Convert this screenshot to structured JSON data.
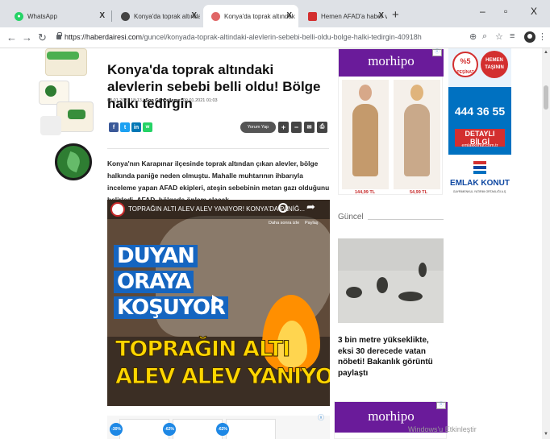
{
  "browser": {
    "tabs": [
      {
        "title": "WhatsApp",
        "favicon_color": "#25d366",
        "active": false
      },
      {
        "title": "Konya'da toprak altındaki alevlerin",
        "favicon_color": "#444444",
        "active": false
      },
      {
        "title": "Konya'da toprak altındaki alevle",
        "favicon_color": "#e06666",
        "active": true
      },
      {
        "title": "Hemen AFAD'a haber verdiler! To",
        "favicon_color": "#d32f2f",
        "active": false
      }
    ],
    "tab_close": "X",
    "new_tab": "+",
    "window_controls": {
      "minimize": "–",
      "maximize": "▫",
      "close": "X"
    },
    "url_host": "https://haberdairesi.com",
    "url_path": "/guncel/konyada-toprak-altindaki-alevlerin-sebebi-belli-oldu-bolge-halki-tedirgin-40918h",
    "icons": [
      "back-icon",
      "forward-icon",
      "reload-icon",
      "lock-icon",
      "translate-icon",
      "zoom-icon",
      "star-icon",
      "playlist-icon",
      "profile-icon",
      "menu-icon"
    ]
  },
  "article": {
    "headline": "Konya'da toprak altındaki alevlerin sebebi belli oldu! Bölge halkı tedirgin",
    "published": "08.01.2021 18:13",
    "updated_label": "Son Güncelleme:",
    "updated": "09.01.2021 01:03",
    "share": [
      "f",
      "t",
      "in",
      "w"
    ],
    "share_colors": [
      "#3b5998",
      "#1da1f2",
      "#0077b5",
      "#25d366"
    ],
    "comment_button": "Yorum Yap",
    "font_plus": "+",
    "font_minus": "−",
    "lead": "Konya'nın Karapınar ilçesinde toprak altından çıkan alevler, bölge halkında paniğe neden olmuştu. Mahalle muhtarının ihbarıyla inceleme yapan AFAD ekipleri, ateşin sebebinin metan gazı olduğunu belirledi. AFAD, bölgede önlem alacak."
  },
  "video": {
    "title": "TOPRAĞIN ALTI ALEV ALEV YANIYOR! KONYA'DA PANİĞ...",
    "watch_later": "Daha sonra izle",
    "share_label": "Paylaş",
    "overlay_lines": [
      "DUYAN",
      "ORAYA",
      "KOŞUYOR",
      "TOPRAĞIN ALTI",
      "ALEV ALEV YANIYOR"
    ]
  },
  "bottom_ad": {
    "discounts": [
      "-30%",
      "-62%",
      "-62%"
    ],
    "close": "ⓧ"
  },
  "right_ads": {
    "morhipo": {
      "brand": "morhipo",
      "chip": "ⓧ",
      "prices": [
        "144,99 TL",
        "54,99 TL"
      ]
    },
    "emlak": {
      "percent": "%5",
      "pesinat": "PEŞİNAT",
      "hemen_line1": "HEMEN",
      "hemen_line2": "TAŞININ",
      "phone_line1": "444 36 55",
      "detayli": "DETAYLI BİLGİ",
      "url": "emlakkonut.com.tr",
      "name": "EMLAK KONUT",
      "sub": "GAYRİMENKUL YATIRIM ORTAKLIĞI A.Ş."
    }
  },
  "guncel": {
    "label": "Güncel",
    "headline": "3 bin metre yükseklikte, eksi 30 derecede vatan nöbeti! Bakanlık görüntü paylaştı"
  },
  "watermark": "Windows'u Etkinleştir"
}
